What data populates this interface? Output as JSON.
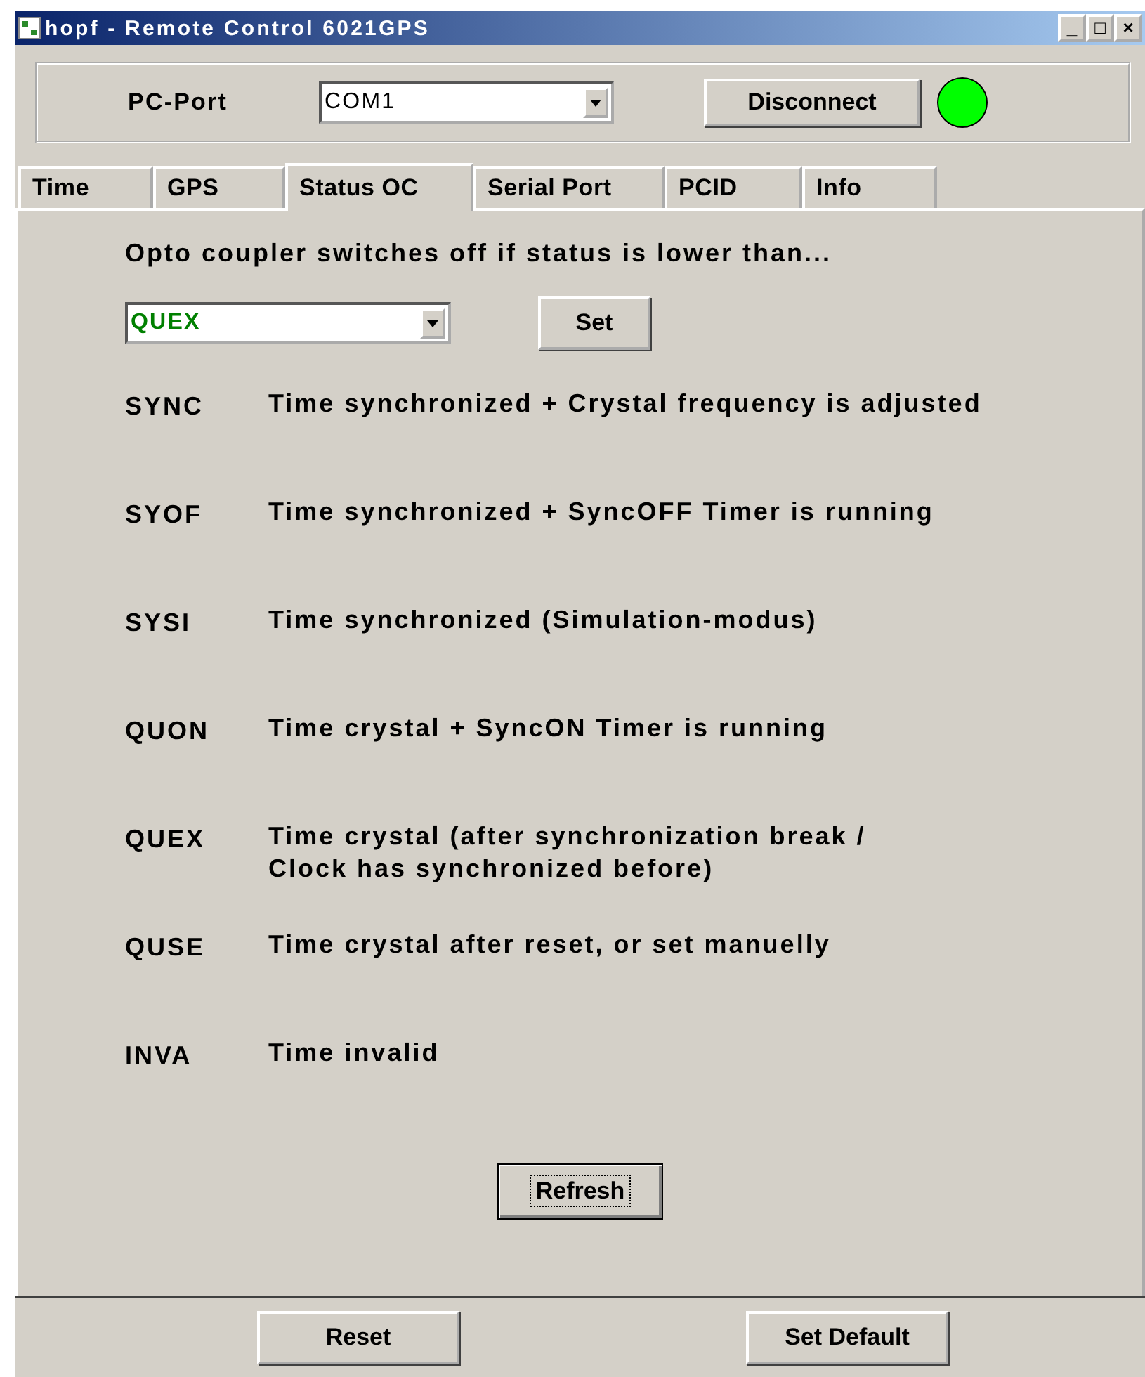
{
  "window": {
    "title": "hopf - Remote Control 6021GPS",
    "controls": [
      "_",
      "□",
      "×"
    ]
  },
  "connection": {
    "port_label": "PC-Port",
    "port": "COM1",
    "button": "Disconnect",
    "connected": true
  },
  "tabs": [
    {
      "label": "Time",
      "selected": false
    },
    {
      "label": "GPS",
      "selected": false
    },
    {
      "label": "Status OC",
      "selected": true
    },
    {
      "label": "Serial Port",
      "selected": false
    },
    {
      "label": "PCID",
      "selected": false
    },
    {
      "label": "Info",
      "selected": false
    }
  ],
  "intro": "Opto coupler switches off if status is lower than...",
  "threshold": {
    "value": "QUEX",
    "button": "Set"
  },
  "statuses": [
    {
      "code": "SYNC",
      "description": "Time synchronized + Crystal frequency is adjusted"
    },
    {
      "code": "SYOF",
      "description": "Time synchronized + SyncOFF Timer is running"
    },
    {
      "code": "SYSI",
      "description": "Time synchronized (Simulation-modus)"
    },
    {
      "code": "QUON",
      "description": "Time crystal + SyncON Timer is running"
    },
    {
      "code": "QUEX",
      "description": "Time crystal (after synchronization break /\nClock has synchronized before)"
    },
    {
      "code": "QUSE",
      "description": "Time crystal after reset, or set manuelly"
    },
    {
      "code": "INVA",
      "description": "Time invalid"
    }
  ],
  "refresh": {
    "label": "Refresh",
    "focused": true
  },
  "footer_buttons": [
    "Reset",
    "Set Default"
  ]
}
